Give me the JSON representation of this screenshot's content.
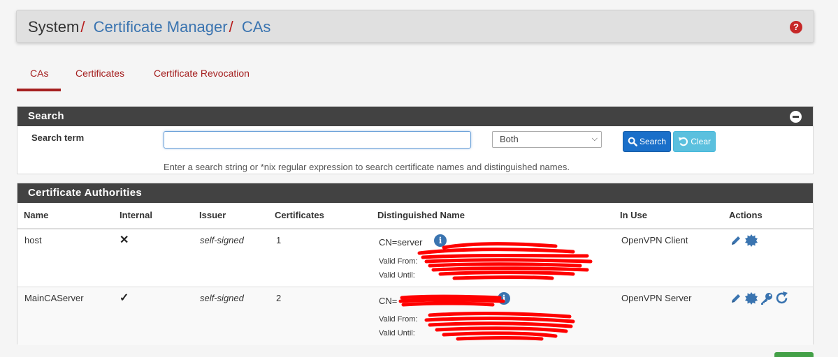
{
  "breadcrumb": {
    "items": [
      "System",
      "Certificate Manager",
      "CAs"
    ],
    "separator": "/"
  },
  "tabs": [
    {
      "label": "CAs",
      "active": true
    },
    {
      "label": "Certificates",
      "active": false
    },
    {
      "label": "Certificate Revocation",
      "active": false
    }
  ],
  "search": {
    "title": "Search",
    "term_label": "Search term",
    "input_value": "",
    "scope_selected": "Both",
    "search_button": "Search",
    "clear_button": "Clear",
    "help_text": "Enter a search string or *nix regular expression to search certificate names and distinguished names."
  },
  "ca_table": {
    "title": "Certificate Authorities",
    "columns": [
      "Name",
      "Internal",
      "Issuer",
      "Certificates",
      "Distinguished Name",
      "In Use",
      "Actions"
    ],
    "rows": [
      {
        "name": "host",
        "internal": "✕",
        "issuer": "self-signed",
        "certificates": "1",
        "dn": "CN=server",
        "valid_from": "Valid From:",
        "valid_until": "Valid Until:",
        "in_use": "OpenVPN Client",
        "actions": [
          "edit-icon",
          "export-icon"
        ]
      },
      {
        "name": "MainCAServer",
        "internal": "✓",
        "issuer": "self-signed",
        "certificates": "2",
        "dn": "CN=",
        "valid_from": "Valid From:",
        "valid_until": "Valid Until:",
        "in_use": "OpenVPN Server",
        "actions": [
          "edit-icon",
          "export-icon",
          "key-icon",
          "reissue-icon"
        ]
      }
    ]
  },
  "colors": {
    "accent_red": "#a51f1f",
    "link_blue": "#3a74b0",
    "panel_header": "#424242",
    "redaction": "#ff0000"
  }
}
